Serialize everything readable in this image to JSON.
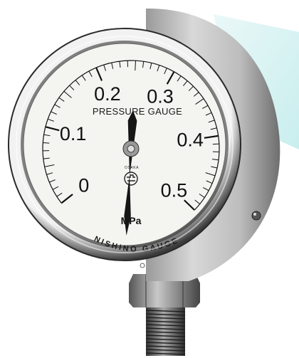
{
  "gauge": {
    "title": "PRESSURE GAUGE",
    "unit": "MPa",
    "brand": "NISHINO GAUGE",
    "maker_city": "OSAKA",
    "scale_labels": [
      "0",
      "0.1",
      "0.2",
      "0.3",
      "0.4",
      "0.5"
    ],
    "scale_min": 0,
    "scale_max": 0.5,
    "pointer_reading": 0.25,
    "emblem": "maker-logo"
  }
}
